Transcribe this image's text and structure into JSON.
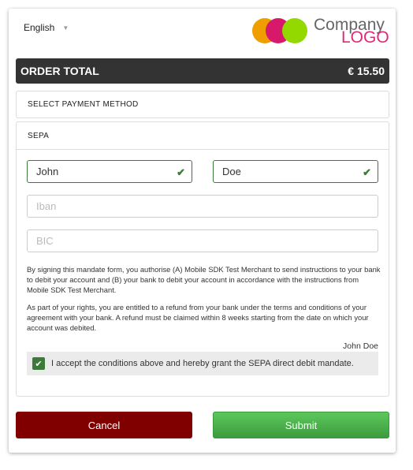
{
  "header": {
    "language": "English",
    "logo": {
      "line1": "Company",
      "line2": "LOGO",
      "colors": [
        "#f09d00",
        "#d6196b",
        "#93d900"
      ]
    }
  },
  "order": {
    "label": "ORDER TOTAL",
    "amount": "€ 15.50"
  },
  "select_payment": {
    "label": "SELECT PAYMENT METHOD"
  },
  "sepa": {
    "title": "SEPA",
    "first_name": {
      "value": "John"
    },
    "last_name": {
      "value": "Doe"
    },
    "iban": {
      "placeholder": "Iban"
    },
    "bic": {
      "placeholder": "BIC"
    },
    "mandate_text_1": "By signing this mandate form, you authorise (A) Mobile SDK Test Merchant to send instructions to your bank to debit your account and (B) your bank to debit your account in accordance with the instructions from Mobile SDK Test Merchant.",
    "mandate_text_2": "As part of your rights, you are entitled to a refund from your bank under the terms and conditions of your agreement with your bank. A refund must be claimed within 8 weeks starting from the date on which your account was debited.",
    "signature": "John Doe",
    "accept_label": "I accept the conditions above and hereby grant the SEPA direct debit mandate.",
    "accept_checked": true
  },
  "buttons": {
    "cancel": "Cancel",
    "submit": "Submit",
    "cancel_color": "#800000",
    "submit_color": "#4cae4c"
  }
}
